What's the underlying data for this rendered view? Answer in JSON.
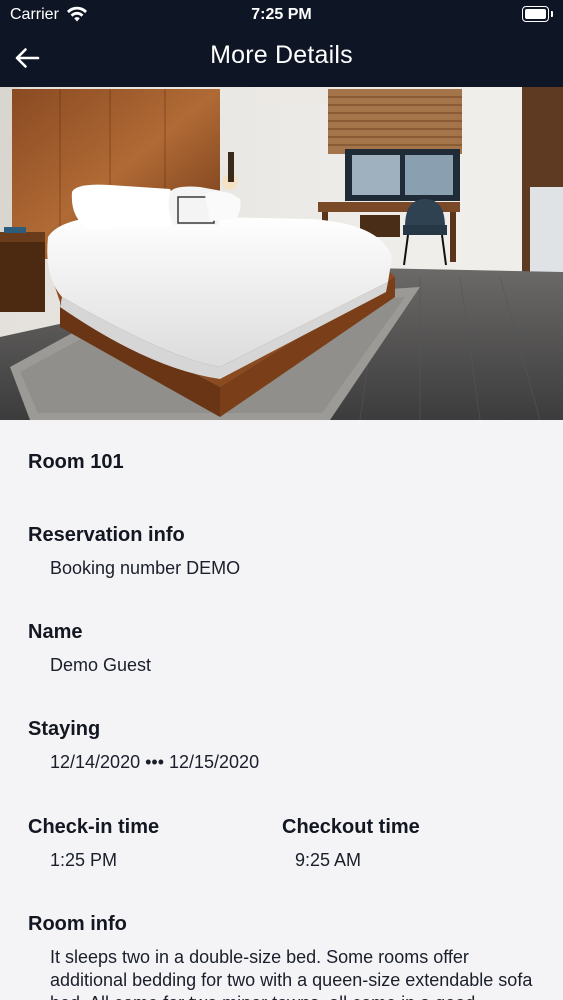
{
  "status_bar": {
    "carrier": "Carrier",
    "time": "7:25 PM",
    "icons": [
      "wifi-icon",
      "battery-icon"
    ]
  },
  "nav": {
    "title": "More Details",
    "back_icon": "arrow-left-icon"
  },
  "hero_image": {
    "subject": "hotel-room-photo"
  },
  "details": {
    "room_title": "Room 101",
    "reservation": {
      "heading": "Reservation info",
      "value": "Booking number DEMO"
    },
    "name": {
      "heading": "Name",
      "value": "Demo Guest"
    },
    "staying": {
      "heading": "Staying",
      "value": "12/14/2020 ••• 12/15/2020"
    },
    "checkin": {
      "heading": "Check-in time",
      "value": "1:25 PM"
    },
    "checkout": {
      "heading": "Checkout time",
      "value": "9:25 AM"
    },
    "room_info": {
      "heading": "Room info",
      "value": "It sleeps two in a double-size bed. Some rooms offer additional bedding for two with a queen-size extendable sofa bed. All come for two minor towns, all come in a good"
    }
  },
  "colors": {
    "header_bg": "#0e1626",
    "page_bg": "#f4f4f6",
    "text": "#131722"
  }
}
